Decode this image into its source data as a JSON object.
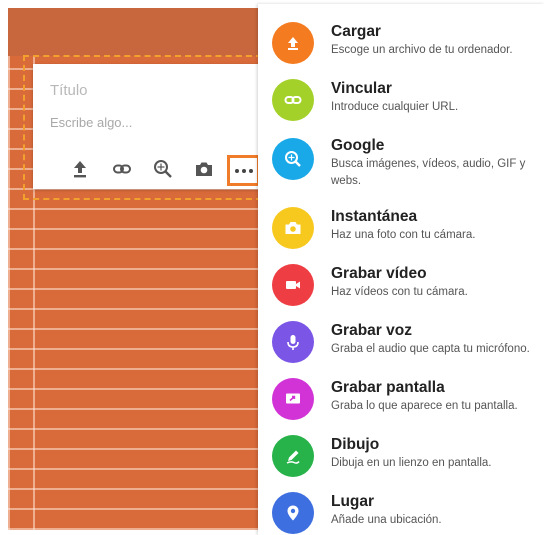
{
  "note_card": {
    "title_placeholder": "Título",
    "body_placeholder": "Escribe algo...",
    "toolbar_icons": [
      "upload-icon",
      "link-icon",
      "search-image-icon",
      "camera-icon",
      "more-icon"
    ]
  },
  "menu": {
    "items": [
      {
        "label": "Cargar",
        "description": "Escoge un archivo de tu ordenador.",
        "icon": "upload-icon",
        "color": "#f47b20"
      },
      {
        "label": "Vincular",
        "description": "Introduce cualquier URL.",
        "icon": "link-icon",
        "color": "#a3d12a"
      },
      {
        "label": "Google",
        "description": "Busca imágenes, vídeos, audio, GIF y webs.",
        "icon": "google-search-icon",
        "color": "#1aa9e8"
      },
      {
        "label": "Instantánea",
        "description": "Haz una foto con tu cámara.",
        "icon": "camera-icon",
        "color": "#f7c81e"
      },
      {
        "label": "Grabar vídeo",
        "description": "Haz vídeos con tu cámara.",
        "icon": "video-icon",
        "color": "#ee3e43"
      },
      {
        "label": "Grabar voz",
        "description": "Graba el audio que capta tu micrófono.",
        "icon": "microphone-icon",
        "color": "#7a55e6"
      },
      {
        "label": "Grabar pantalla",
        "description": "Graba lo que aparece en tu pantalla.",
        "icon": "screen-record-icon",
        "color": "#d233d6"
      },
      {
        "label": "Dibujo",
        "description": "Dibuja en un lienzo en pantalla.",
        "icon": "draw-icon",
        "color": "#27b24a"
      },
      {
        "label": "Lugar",
        "description": "Añade una ubicación.",
        "icon": "location-icon",
        "color": "#3e6fe0"
      }
    ]
  }
}
